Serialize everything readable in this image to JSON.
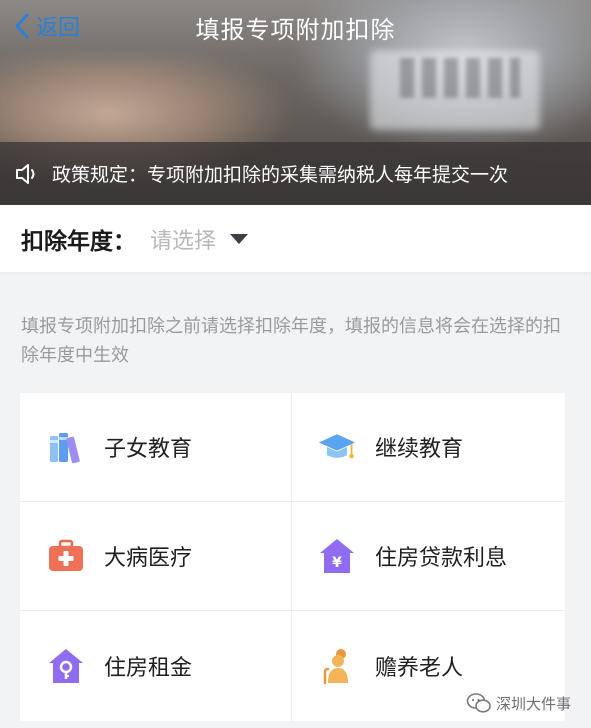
{
  "nav": {
    "back_label": "返回",
    "title": "填报专项附加扣除"
  },
  "notice": {
    "icon": "speaker-icon",
    "text": "政策规定：专项附加扣除的采集需纳税人每年提交一次"
  },
  "year_selector": {
    "label": "扣除年度：",
    "placeholder": "请选择"
  },
  "hint": "填报专项附加扣除之前请选择扣除年度，填报的信息将会在选择的扣除年度中生效",
  "items": [
    {
      "label": "子女教育",
      "icon": "books-icon"
    },
    {
      "label": "继续教育",
      "icon": "graduation-cap-icon"
    },
    {
      "label": "大病医疗",
      "icon": "medical-kit-icon"
    },
    {
      "label": "住房贷款利息",
      "icon": "house-yen-icon"
    },
    {
      "label": "住房租金",
      "icon": "house-key-icon"
    },
    {
      "label": "赡养老人",
      "icon": "elderly-icon"
    }
  ],
  "watermark": {
    "text": "深圳大件事",
    "icon": "wechat-logo-icon"
  },
  "colors": {
    "accent": "#2a7fd9",
    "text_primary": "#1f1f22",
    "text_hint": "#9a9a9e",
    "placeholder": "#b8b8bc",
    "page_background": "#f2f3f5"
  }
}
